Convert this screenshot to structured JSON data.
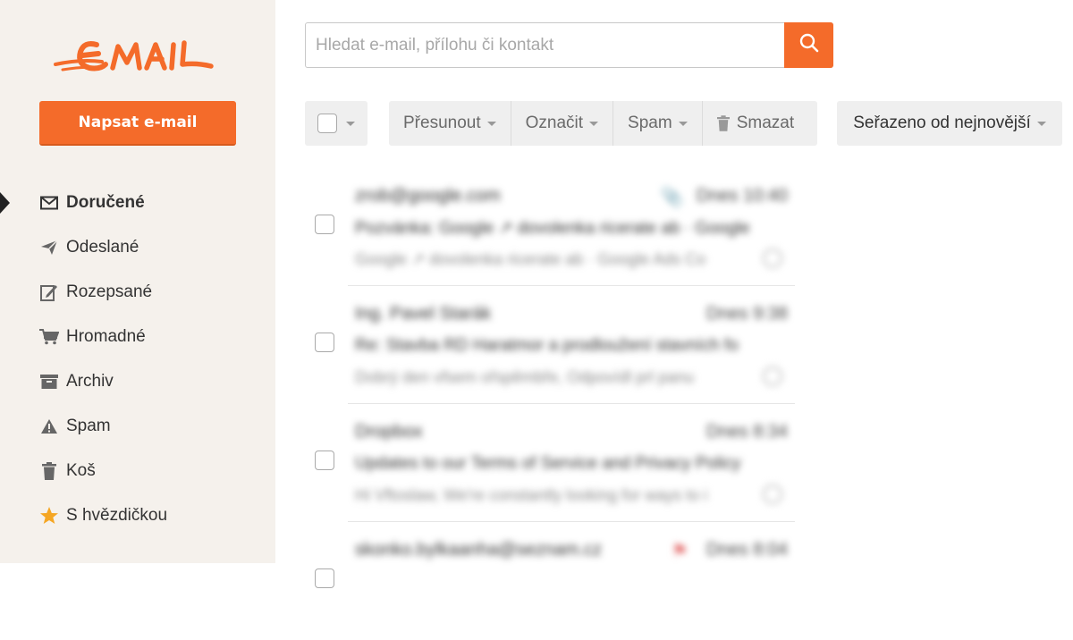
{
  "brand": {
    "logo_text": "EMAIL",
    "accent": "#f46b2a",
    "sidebar_bg": "#f5f1ec"
  },
  "compose": {
    "label": "Napsat e-mail"
  },
  "nav": {
    "items": [
      {
        "label": "Doručené",
        "icon": "envelope-icon",
        "active": true
      },
      {
        "label": "Odeslané",
        "icon": "paper-plane-icon"
      },
      {
        "label": "Rozepsané",
        "icon": "draft-edit-icon"
      },
      {
        "label": "Hromadné",
        "icon": "cart-icon"
      },
      {
        "label": "Archiv",
        "icon": "archive-box-icon"
      },
      {
        "label": "Spam",
        "icon": "warning-icon"
      },
      {
        "label": "Koš",
        "icon": "trash-icon"
      },
      {
        "label": "S hvězdičkou",
        "icon": "star-icon"
      }
    ]
  },
  "search": {
    "placeholder": "Hledat e-mail, přílohu či kontakt",
    "value": "",
    "icon": "search-icon"
  },
  "toolbar": {
    "move_label": "Přesunout",
    "mark_label": "Označit",
    "spam_label": "Spam",
    "delete_label": "Smazat",
    "sort_label": "Seřazeno od nejnovější"
  },
  "emails": [
    {
      "sender": "zrob@google.com",
      "date": "Dnes 10:40",
      "subject": "Pozvánka: Google ↗ dovolenka ricerate ab · Google",
      "preview": "Google ↗ dovolenka ricerate ab · Google Ads Co",
      "attachment": true,
      "flag": false
    },
    {
      "sender": "Ing. Pavel Starák",
      "date": "Dnes 9:38",
      "subject": "Re: Stavba RD Haratmor a prodloužení stavních fo",
      "preview": "Dobrý den vfsem ořspěmbře, Odpovídl prl panu",
      "attachment": false,
      "flag": false
    },
    {
      "sender": "Dropbox",
      "date": "Dnes 8:34",
      "subject": "Updates to our Terms of Service and Privacy Policy",
      "preview": "Hi Vftoslaw, We're constantly looking for ways to i",
      "attachment": false,
      "flag": false
    },
    {
      "sender": "skonko.bylkaanha@seznam.cz",
      "date": "Dnes 8:04",
      "subject": "",
      "preview": "",
      "attachment": false,
      "flag": true
    }
  ]
}
